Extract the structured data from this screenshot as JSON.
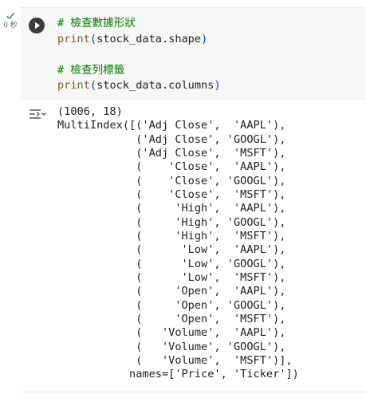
{
  "status": {
    "check_icon": "check-icon",
    "exec_time": "0 秒"
  },
  "cell": {
    "run_icon": "play-icon",
    "code_lines": [
      {
        "kind": "comment",
        "text": "# 檢查數據形狀"
      },
      {
        "kind": "call",
        "func": "print",
        "open": "(",
        "arg": "stock_data.shape",
        "close": ")"
      },
      {
        "kind": "blank",
        "text": ""
      },
      {
        "kind": "comment",
        "text": "# 檢查列標籤"
      },
      {
        "kind": "call",
        "func": "print",
        "open": "(",
        "arg": "stock_data.columns",
        "close": ")"
      }
    ]
  },
  "output": {
    "toggle_icon": "output-toggle-icon",
    "lines": [
      "(1006, 18)",
      "MultiIndex([('Adj Close',  'AAPL'),",
      "            ('Adj Close', 'GOOGL'),",
      "            ('Adj Close',  'MSFT'),",
      "            (    'Close',  'AAPL'),",
      "            (    'Close', 'GOOGL'),",
      "            (    'Close',  'MSFT'),",
      "            (     'High',  'AAPL'),",
      "            (     'High', 'GOOGL'),",
      "            (     'High',  'MSFT'),",
      "            (      'Low',  'AAPL'),",
      "            (      'Low', 'GOOGL'),",
      "            (      'Low',  'MSFT'),",
      "            (     'Open',  'AAPL'),",
      "            (     'Open', 'GOOGL'),",
      "            (     'Open',  'MSFT'),",
      "            (   'Volume',  'AAPL'),",
      "            (   'Volume', 'GOOGL'),",
      "            (   'Volume',  'MSFT')],",
      "           names=['Price', 'Ticker'])"
    ]
  },
  "colors": {
    "comment": "#008000",
    "builtin": "#795e26",
    "paren": "#0431fa",
    "cell_bg": "#f7f7f7",
    "run_button": "#3c3c3c",
    "check": "#1e8e3e"
  }
}
